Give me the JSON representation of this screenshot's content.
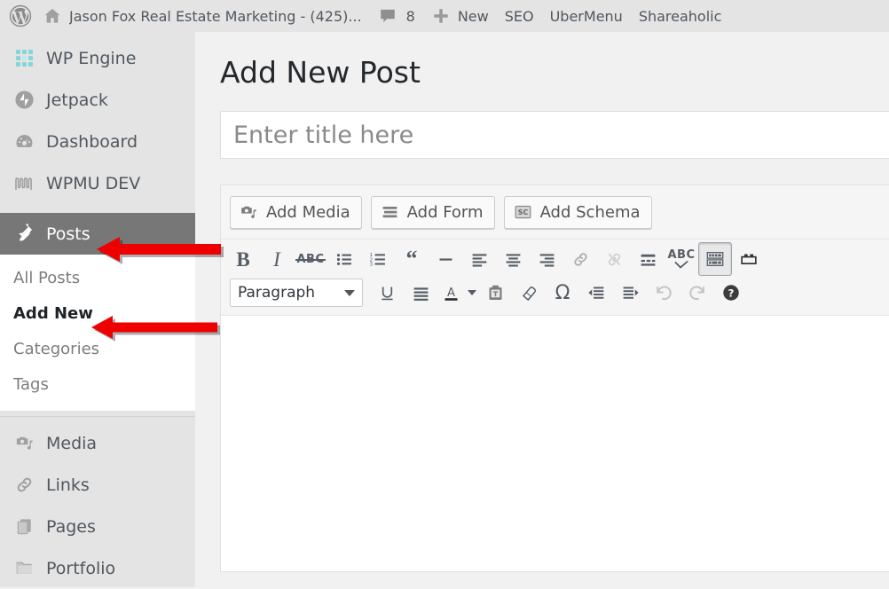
{
  "adminbar": {
    "logo_icon": "wordpress-logo-icon",
    "home_icon": "home-icon",
    "site_title": "Jason Fox Real Estate Marketing - (425)...",
    "comments_icon": "comment-bubble-icon",
    "comments_count": "8",
    "new_icon": "plus-icon",
    "new_label": "New",
    "items": [
      {
        "label": "SEO"
      },
      {
        "label": "UberMenu"
      },
      {
        "label": "Shareaholic"
      }
    ]
  },
  "sidebar": {
    "items": [
      {
        "label": "WP Engine",
        "icon": "wp-engine-icon"
      },
      {
        "label": "Jetpack",
        "icon": "jetpack-icon"
      },
      {
        "label": "Dashboard",
        "icon": "dashboard-gauge-icon"
      },
      {
        "label": "WPMU DEV",
        "icon": "wpmu-dev-icon"
      },
      {
        "label": "Posts",
        "icon": "pushpin-icon"
      },
      {
        "label": "Media",
        "icon": "media-camera-icon"
      },
      {
        "label": "Links",
        "icon": "link-chain-icon"
      },
      {
        "label": "Pages",
        "icon": "pages-icon"
      },
      {
        "label": "Portfolio",
        "icon": "folder-icon"
      }
    ],
    "submenu": [
      {
        "label": "All Posts"
      },
      {
        "label": "Add New"
      },
      {
        "label": "Categories"
      },
      {
        "label": "Tags"
      }
    ]
  },
  "main": {
    "page_title": "Add New Post",
    "title_placeholder": "Enter title here",
    "title_value": "",
    "media_buttons": [
      {
        "label": "Add Media",
        "icon": "add-media-icon"
      },
      {
        "label": "Add Form",
        "icon": "add-form-icon"
      },
      {
        "label": "Add Schema",
        "icon": "add-schema-sc-icon"
      }
    ],
    "toolbar_row1": [
      {
        "name": "bold",
        "icon": "bold-icon",
        "glyph": "B"
      },
      {
        "name": "italic",
        "icon": "italic-icon",
        "glyph": "I"
      },
      {
        "name": "strikethrough",
        "icon": "strikethrough-abc-icon",
        "glyph": "ABC"
      },
      {
        "name": "bullet-list",
        "icon": "bullet-list-icon"
      },
      {
        "name": "numbered-list",
        "icon": "numbered-list-icon"
      },
      {
        "name": "blockquote",
        "icon": "blockquote-icon",
        "glyph": "“"
      },
      {
        "name": "horizontal-rule",
        "icon": "horizontal-rule-icon"
      },
      {
        "name": "align-left",
        "icon": "align-left-icon"
      },
      {
        "name": "align-center",
        "icon": "align-center-icon"
      },
      {
        "name": "align-right",
        "icon": "align-right-icon"
      },
      {
        "name": "insert-link",
        "icon": "link-icon"
      },
      {
        "name": "remove-link",
        "icon": "unlink-icon"
      },
      {
        "name": "read-more",
        "icon": "read-more-icon"
      },
      {
        "name": "spellcheck",
        "icon": "spellcheck-abc-icon",
        "glyph": "ABC"
      },
      {
        "name": "toolbar-toggle",
        "icon": "toolbar-toggle-icon"
      },
      {
        "name": "fullscreen",
        "icon": "fullscreen-icon"
      }
    ],
    "paragraph_select": {
      "value": "Paragraph"
    },
    "toolbar_row2": [
      {
        "name": "underline",
        "icon": "underline-icon",
        "glyph": "U"
      },
      {
        "name": "justify",
        "icon": "align-justify-icon"
      },
      {
        "name": "text-color",
        "icon": "text-color-icon",
        "glyph": "A"
      },
      {
        "name": "paste-as-text",
        "icon": "paste-as-text-icon"
      },
      {
        "name": "clear-formatting",
        "icon": "eraser-icon"
      },
      {
        "name": "special-character",
        "icon": "omega-icon",
        "glyph": "Ω"
      },
      {
        "name": "outdent",
        "icon": "outdent-icon"
      },
      {
        "name": "indent",
        "icon": "indent-icon"
      },
      {
        "name": "undo",
        "icon": "undo-icon"
      },
      {
        "name": "redo",
        "icon": "redo-icon"
      },
      {
        "name": "keyboard-shortcuts",
        "icon": "help-icon",
        "glyph": "?"
      }
    ],
    "editor_content": ""
  },
  "annotations": [
    {
      "name": "arrow-pointing-to-posts",
      "target": "Posts",
      "color": "#ee0000",
      "direction": "left"
    },
    {
      "name": "arrow-pointing-to-add-new",
      "target": "Add New",
      "color": "#ee0000",
      "direction": "left"
    }
  ],
  "colors": {
    "chrome_grey": "#e4e4e4",
    "current_menu": "#777777",
    "content_bg": "#f1f1f1",
    "arrow_red": "#ee0000",
    "wp_engine_teal": "#86d6d9"
  }
}
